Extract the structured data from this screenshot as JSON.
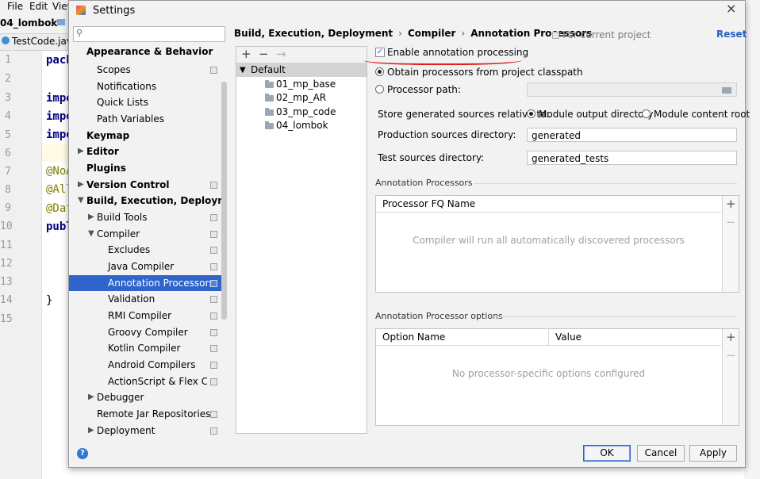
{
  "ide": {
    "menu": [
      "File",
      "Edit",
      "View"
    ],
    "project": "04_lombok",
    "file_tab": "TestCode.java",
    "line_numbers": [
      "1",
      "2",
      "3",
      "4",
      "5",
      "6",
      "7",
      "8",
      "9",
      "10",
      "11",
      "12",
      "13",
      "14",
      "15"
    ],
    "code": {
      "l1": "pack",
      "l3": "impo",
      "l4": "impo",
      "l5": "impo",
      "l7": "@NoA",
      "l8": "@All",
      "l9": "@Dat",
      "l10": "publ",
      "l14": "}"
    }
  },
  "dialog": {
    "title": "Settings",
    "close": "×",
    "search": {
      "value": "",
      "placeholder": ""
    },
    "tree": [
      {
        "label": "Appearance & Behavior",
        "bold": true
      },
      {
        "label": "Scopes"
      },
      {
        "label": "Notifications"
      },
      {
        "label": "Quick Lists"
      },
      {
        "label": "Path Variables"
      },
      {
        "label": "Keymap",
        "bold": true
      },
      {
        "label": "Editor",
        "bold": true
      },
      {
        "label": "Plugins",
        "bold": true
      },
      {
        "label": "Version Control",
        "bold": true
      },
      {
        "label": "Build, Execution, Deployment",
        "bold": true
      },
      {
        "label": "Build Tools"
      },
      {
        "label": "Compiler"
      },
      {
        "label": "Excludes"
      },
      {
        "label": "Java Compiler"
      },
      {
        "label": "Annotation Processors",
        "selected": true
      },
      {
        "label": "Validation"
      },
      {
        "label": "RMI Compiler"
      },
      {
        "label": "Groovy Compiler"
      },
      {
        "label": "Kotlin Compiler"
      },
      {
        "label": "Android Compilers"
      },
      {
        "label": "ActionScript & Flex Compiler"
      },
      {
        "label": "Debugger"
      },
      {
        "label": "Remote Jar Repositories"
      },
      {
        "label": "Deployment"
      }
    ],
    "breadcrumb": [
      "Build, Execution, Deployment",
      "Compiler",
      "Annotation Processors"
    ],
    "breadcrumb_sep": "›",
    "for_current_project": "For current project",
    "reset": "Reset",
    "profiles_toolbar": {
      "add": "+",
      "remove": "−",
      "move": "→"
    },
    "profiles": {
      "default": "Default",
      "modules": [
        "01_mp_base",
        "02_mp_AR",
        "03_mp_code",
        "04_lombok"
      ]
    },
    "enable_annotation": {
      "label": "Enable annotation processing",
      "checked": true
    },
    "obtain_from_classpath": {
      "label": "Obtain processors from project classpath",
      "selected": true
    },
    "processor_path": {
      "label": "Processor path:",
      "value": ""
    },
    "store_generated": {
      "label": "Store generated sources relative to:",
      "option_module_output": "Module output directory",
      "option_module_content": "Module content root",
      "selected": "Module output directory"
    },
    "production_sources": {
      "label": "Production sources directory:",
      "value": "generated"
    },
    "test_sources": {
      "label": "Test sources directory:",
      "value": "generated_tests"
    },
    "annotation_processors": {
      "section": "Annotation Processors",
      "column": "Processor FQ Name",
      "empty": "Compiler will run all automatically discovered processors",
      "add": "+",
      "remove": "−"
    },
    "processor_options": {
      "section": "Annotation Processor options",
      "col_name": "Option Name",
      "col_value": "Value",
      "empty": "No processor-specific options configured",
      "add": "+",
      "remove": "−"
    },
    "help": "?",
    "buttons": {
      "ok": "OK",
      "cancel": "Cancel",
      "apply": "Apply"
    }
  },
  "colors": {
    "selection": "#2f65ca",
    "link": "#2563c4",
    "annotation_underline": "#e0201a"
  }
}
